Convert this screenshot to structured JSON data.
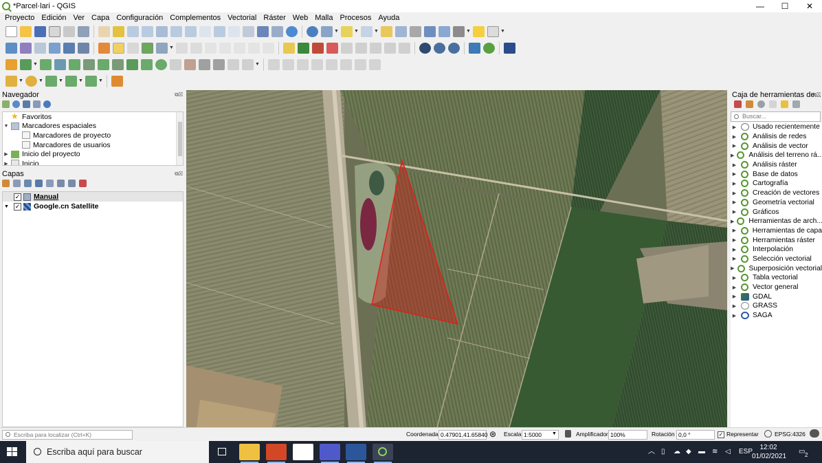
{
  "window": {
    "title": "*Parcel·lari - QGIS",
    "minimize": "—",
    "maximize": "☐",
    "close": "✕"
  },
  "menu": [
    "Proyecto",
    "Edición",
    "Ver",
    "Capa",
    "Configuración",
    "Complementos",
    "Vectorial",
    "Ráster",
    "Web",
    "Malla",
    "Procesos",
    "Ayuda"
  ],
  "navigator": {
    "title": "Navegador",
    "items": [
      {
        "label": "Favoritos",
        "arrow": "",
        "indent": 0
      },
      {
        "label": "Marcadores espaciales",
        "arrow": "▼",
        "indent": 0
      },
      {
        "label": "Marcadores de proyecto",
        "arrow": "",
        "indent": 1
      },
      {
        "label": "Marcadores de usuarios",
        "arrow": "",
        "indent": 1
      },
      {
        "label": "Inicio del proyecto",
        "arrow": "▶",
        "indent": 0
      },
      {
        "label": "Inicio",
        "arrow": "▶",
        "indent": 0
      }
    ]
  },
  "layers": {
    "title": "Capas",
    "items": [
      {
        "label": "Manual",
        "checked": true,
        "selected": true,
        "expanded": false
      },
      {
        "label": "Google.cn Satellite",
        "checked": true,
        "selected": false,
        "expanded": true
      }
    ]
  },
  "toolbox": {
    "title": "Caja de herramientas de...",
    "search_placeholder": "Buscar...",
    "items": [
      {
        "label": "Usado recientemente",
        "icon": "clock-icon"
      },
      {
        "label": "Análisis de redes",
        "icon": "qgis-icon"
      },
      {
        "label": "Análisis de vector",
        "icon": "qgis-icon"
      },
      {
        "label": "Análisis del terreno rá...",
        "icon": "qgis-icon"
      },
      {
        "label": "Análisis ráster",
        "icon": "qgis-icon"
      },
      {
        "label": "Base de datos",
        "icon": "qgis-icon"
      },
      {
        "label": "Cartografía",
        "icon": "qgis-icon"
      },
      {
        "label": "Creación de vectores",
        "icon": "qgis-icon"
      },
      {
        "label": "Geometría vectorial",
        "icon": "qgis-icon"
      },
      {
        "label": "Gráficos",
        "icon": "qgis-icon"
      },
      {
        "label": "Herramientas de arch...",
        "icon": "qgis-icon"
      },
      {
        "label": "Herramientas de capa",
        "icon": "qgis-icon"
      },
      {
        "label": "Herramientas ráster",
        "icon": "qgis-icon"
      },
      {
        "label": "Interpolación",
        "icon": "qgis-icon"
      },
      {
        "label": "Selección vectorial",
        "icon": "qgis-icon"
      },
      {
        "label": "Superposición vectorial",
        "icon": "qgis-icon"
      },
      {
        "label": "Tabla vectorial",
        "icon": "qgis-icon"
      },
      {
        "label": "Vector general",
        "icon": "qgis-icon"
      },
      {
        "label": "GDAL",
        "icon": "gdal-icon"
      },
      {
        "label": "GRASS",
        "icon": "grass-icon"
      },
      {
        "label": "SAGA",
        "icon": "saga-icon"
      }
    ]
  },
  "status": {
    "locate_placeholder": "Escriba para localizar (Ctrl+K)",
    "coord_label": "Coordenada",
    "coord_value": "0.47901,41.65840",
    "scale_label": "Escala",
    "scale_value": "1:5000",
    "magnifier_label": "Amplificador",
    "magnifier_value": "100%",
    "rotation_label": "Rotación",
    "rotation_value": "0,0 °",
    "render_label": "Representar",
    "crs": "EPSG:4326"
  },
  "taskbar": {
    "search_placeholder": "Escriba aquí para buscar",
    "language": "ESP",
    "time": "12:02",
    "date": "01/02/2021",
    "notifications": "2"
  },
  "colors": {
    "accent": "#589632",
    "polygon_stroke": "#e0201a",
    "taskbar": "#1c2331"
  }
}
